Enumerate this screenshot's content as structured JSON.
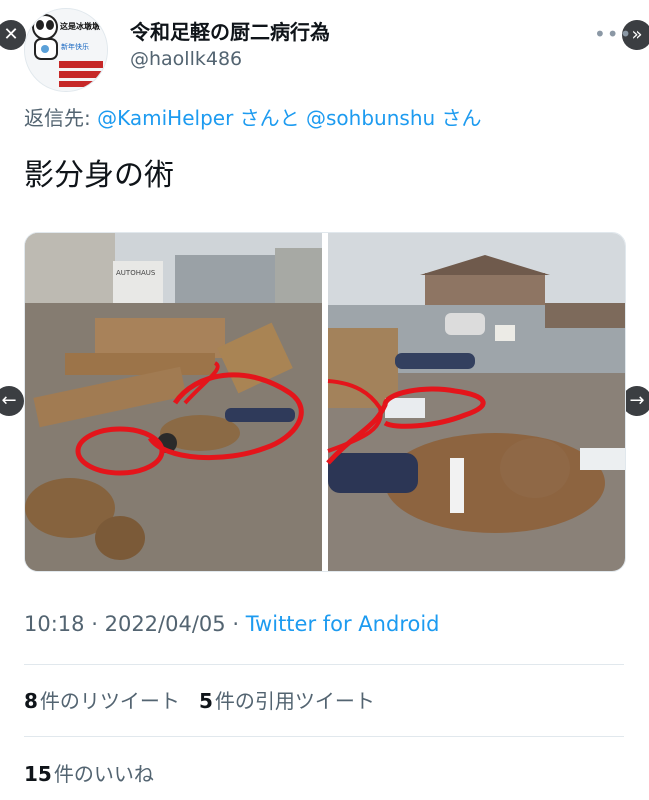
{
  "tweet": {
    "display_name": "令和足軽の厨二病行為",
    "handle": "@haollk486",
    "reply_prefix": "返信先: ",
    "reply_to_1": "@KamiHelper",
    "reply_connector": "さんと",
    "reply_to_2": "@sohbunshu",
    "reply_suffix": "さん",
    "text": "影分身の術",
    "time": "10:18",
    "date": "2022/04/05",
    "source": "Twitter for Android",
    "separator": "·"
  },
  "avatar": {
    "line1": "这是冰墩墩",
    "line2": "新年快乐"
  },
  "photo_left": {
    "sign_text": "AUTOHAUS"
  },
  "stats": {
    "retweets_count": "8",
    "retweets_label": "件のリツイート",
    "quotes_count": "5",
    "quotes_label": "件の引用ツイート",
    "likes_count": "15",
    "likes_label": "件のいいね"
  },
  "nav": {
    "close_glyph": "✕",
    "next_glyph": "»",
    "prev_glyph": "←",
    "fwd_glyph": "→",
    "more_glyph": "•••"
  },
  "colors": {
    "link": "#1d9bf0",
    "secondary": "#536471",
    "annotation": "#e4151b"
  }
}
